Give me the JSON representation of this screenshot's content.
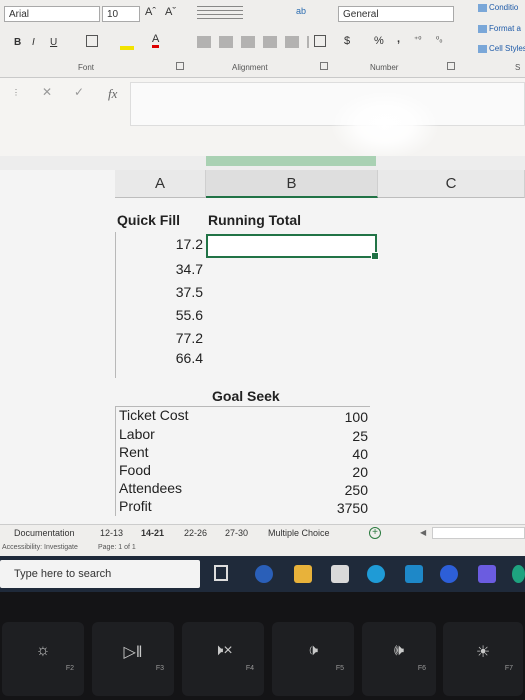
{
  "ribbon": {
    "font_name": "Arial",
    "font_size": "10",
    "grow_font": "Aˆ",
    "shrink_font": "Aˇ",
    "bold": "B",
    "italic": "I",
    "underline": "U",
    "font_color": "A",
    "number_format": "General",
    "currency": "$",
    "percent": "%",
    "comma": ",",
    "inc_decimal": "⁺⁰",
    "dec_decimal": "⁰₀",
    "group_font": "Font",
    "group_alignment": "Alignment",
    "group_number": "Number",
    "conditional": "Conditio",
    "format_as": "Format a",
    "cell_styles": "Cell Styles",
    "styles_partial": "S"
  },
  "formula_bar": {
    "fx": "fx",
    "cancel": "✕",
    "enter": "✓"
  },
  "columns": [
    {
      "label": "A"
    },
    {
      "label": "B"
    },
    {
      "label": "C"
    }
  ],
  "sheet": {
    "quick_fill_header": "Quick Fill",
    "running_total_header": "Running Total",
    "values": [
      "17.2",
      "34.7",
      "37.5",
      "55.6",
      "77.2",
      "66.4"
    ],
    "goal_seek_header": "Goal Seek",
    "goal_rows": [
      {
        "label": "Ticket Cost",
        "value": "100"
      },
      {
        "label": "Labor",
        "value": "25"
      },
      {
        "label": "Rent",
        "value": "40"
      },
      {
        "label": "Food",
        "value": "20"
      },
      {
        "label": "Attendees",
        "value": "250"
      },
      {
        "label": "Profit",
        "value": "3750"
      }
    ]
  },
  "tabs": [
    "Documentation",
    "12-13",
    "14-21",
    "22-26",
    "27-30",
    "Multiple Choice"
  ],
  "active_tab": "14-21",
  "status": {
    "accessibility": "Accessibility: Investigate",
    "page": "Page: 1 of 1"
  },
  "taskbar": {
    "search_placeholder": "Type here to search"
  },
  "function_keys": [
    "F2",
    "F3",
    "F4",
    "F5",
    "F6",
    "F7"
  ],
  "colors": {
    "excel_green": "#217346",
    "taskbar": "#1f2a3a"
  }
}
